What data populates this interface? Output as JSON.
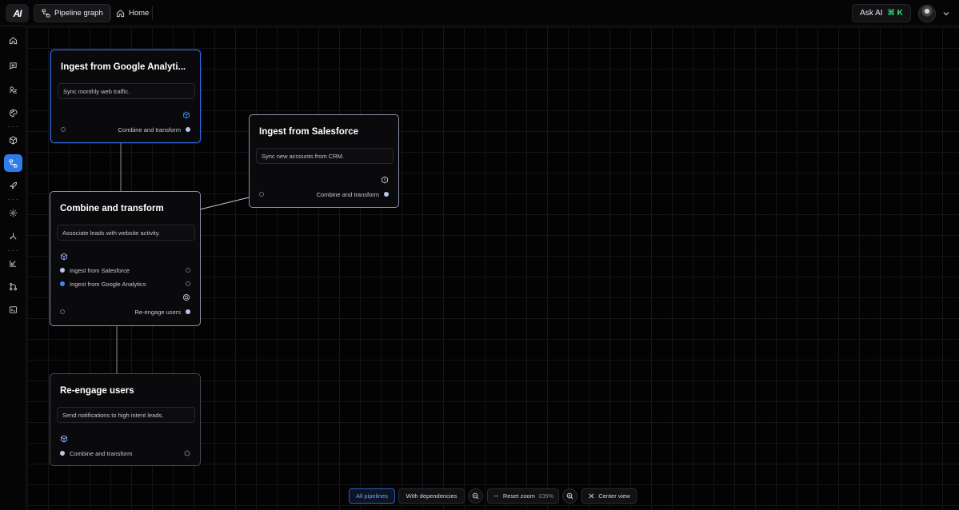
{
  "header": {
    "logo_text": "AI",
    "tabs": [
      {
        "label": "Pipeline graph",
        "icon": "graph-icon",
        "active": true
      },
      {
        "label": "Home",
        "icon": "home-icon",
        "active": false
      }
    ],
    "ask_ai": {
      "label": "Ask AI",
      "shortcut": "⌘ K"
    }
  },
  "sidebar": {
    "items": [
      {
        "name": "home",
        "icon": "home-icon",
        "active": false
      },
      {
        "name": "chat",
        "icon": "chat-icon",
        "active": false
      },
      {
        "name": "agent",
        "icon": "agent-icon",
        "active": false
      },
      {
        "name": "palette",
        "icon": "palette-icon",
        "active": false
      },
      {
        "name": "box",
        "icon": "box-icon",
        "active": false
      },
      {
        "name": "pipelines",
        "icon": "pipeline-icon",
        "active": true
      },
      {
        "name": "deploy",
        "icon": "rocket-icon",
        "active": false
      },
      {
        "name": "settings",
        "icon": "gear-icon",
        "active": false
      },
      {
        "name": "tree",
        "icon": "tree-icon",
        "active": false
      },
      {
        "name": "import",
        "icon": "import-icon",
        "active": false
      },
      {
        "name": "git",
        "icon": "git-icon",
        "active": false
      },
      {
        "name": "terminal",
        "icon": "terminal-icon",
        "active": false
      }
    ]
  },
  "nodes": {
    "ga": {
      "title": "Ingest from Google Analyti...",
      "description": "Sync monthly web traffic.",
      "output_label": "Combine and transform"
    },
    "sf": {
      "title": "Ingest from Salesforce",
      "description": "Sync new accounts from CRM.",
      "output_label": "Combine and transform"
    },
    "ct": {
      "title": "Combine and transform",
      "description": "Associate leads with website activity.",
      "inputs": [
        "Ingest from Salesforce",
        "Ingest from Google Analytics"
      ],
      "output_label": "Re-engage users"
    },
    "re": {
      "title": "Re-engage users",
      "description": "Send notifications to high intent leads.",
      "input_label": "Combine and transform"
    }
  },
  "toolbar": {
    "all_pipelines": "All pipelines",
    "with_dependencies": "With dependencies",
    "reset_zoom": "Reset zoom",
    "zoom_level": "105%",
    "center_view": "Center view"
  },
  "colors": {
    "accent": "#2f7be8",
    "ask_ai_shortcut": "#3ddc84",
    "selected_border": "#2f6be0"
  }
}
